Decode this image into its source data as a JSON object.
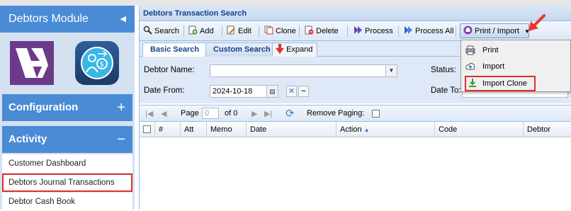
{
  "sidebar": {
    "module_title": "Debtors Module",
    "sections": {
      "configuration": {
        "label": "Configuration",
        "sign": "+"
      },
      "activity": {
        "label": "Activity",
        "sign": "−"
      }
    },
    "items": [
      {
        "label": "Customer Dashboard"
      },
      {
        "label": "Debtors Journal Transactions"
      },
      {
        "label": "Debtor Cash Book"
      }
    ]
  },
  "panel": {
    "title": "Debtors Transaction Search",
    "toolbar": {
      "search": "Search",
      "add": "Add",
      "edit": "Edit",
      "clone": "Clone",
      "delete": "Delete",
      "process": "Process",
      "process_all": "Process All",
      "print_import": "Print / Import"
    },
    "tabs": {
      "basic": "Basic Search",
      "custom": "Custom Search",
      "expand": "Expand"
    },
    "form": {
      "debtor_name_label": "Debtor Name:",
      "debtor_name_value": "",
      "date_from_label": "Date From:",
      "date_from_value": "2024-10-18",
      "status_label": "Status:",
      "date_to_label": "Date To:"
    },
    "pager": {
      "page_label": "Page",
      "page_value": "0",
      "of_label": "of 0",
      "remove_paging": "Remove Paging:"
    },
    "columns": [
      "#",
      "Att",
      "Memo",
      "Date",
      "Action",
      "Code",
      "Debtor"
    ]
  },
  "print_menu": {
    "items": [
      {
        "label": "Print"
      },
      {
        "label": "Import"
      },
      {
        "label": "Import Clone"
      }
    ]
  }
}
